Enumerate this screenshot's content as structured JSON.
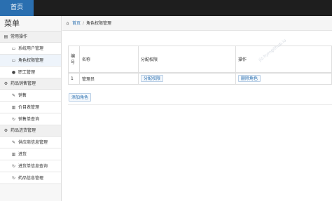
{
  "topbar": {
    "brand": "首页"
  },
  "sidebar": {
    "title": "菜单",
    "groups": [
      {
        "label": "常用操作",
        "items": [
          {
            "label": "系统用户管理"
          },
          {
            "label": "角色权限管理"
          },
          {
            "label": "职工管理"
          }
        ]
      },
      {
        "label": "药品销售管理",
        "items": [
          {
            "label": "销售"
          },
          {
            "label": "价目表管理"
          },
          {
            "label": "销售单查询"
          }
        ]
      },
      {
        "label": "药品进货管理",
        "items": [
          {
            "label": "供应商信息管理"
          },
          {
            "label": "进货"
          },
          {
            "label": "进货单信息查询"
          },
          {
            "label": "药品信息管理"
          }
        ]
      }
    ]
  },
  "breadcrumb": {
    "home": "首页",
    "current": "角色权限管理"
  },
  "table": {
    "headers": {
      "number": "编号",
      "name": "名称",
      "assign": "分配权限",
      "actions": "操作"
    },
    "rows": [
      {
        "number": "1",
        "name": "管理员",
        "assign": "分配权限",
        "delete": "删除角色"
      }
    ]
  },
  "add_button": "添加角色",
  "watermark": "jiz.hymgithub.io"
}
